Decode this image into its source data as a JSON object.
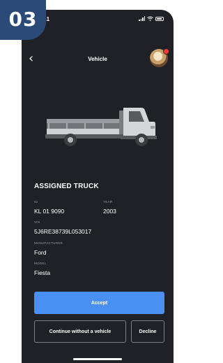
{
  "step_badge": "03",
  "status_bar": {
    "time": "9:41",
    "icons": [
      "signal-icon",
      "wifi-icon",
      "battery-icon"
    ]
  },
  "header": {
    "title": "Vehicle",
    "back_icon": "chevron-left-icon"
  },
  "vehicle_image": "pickup-truck-illustration",
  "section_heading": "ASSIGNED TRUCK",
  "fields": {
    "id": {
      "label": "ID",
      "value": "KL 01 9090"
    },
    "year": {
      "label": "YEAR",
      "value": "2003"
    },
    "vin": {
      "label": "VIN",
      "value": "5J6RE38739L053017"
    },
    "manufacturer": {
      "label": "MANUFACTURER",
      "value": "Ford"
    },
    "model": {
      "label": "MODEL",
      "value": "Fiesta"
    }
  },
  "actions": {
    "accept_label": "Accept",
    "continue_label": "Continue without a vehicle",
    "decline_label": "Decline"
  },
  "colors": {
    "background": "#1f2127",
    "accent": "#4a90f2",
    "badge": "#2b4a78",
    "notification_dot": "#ff3b30"
  }
}
